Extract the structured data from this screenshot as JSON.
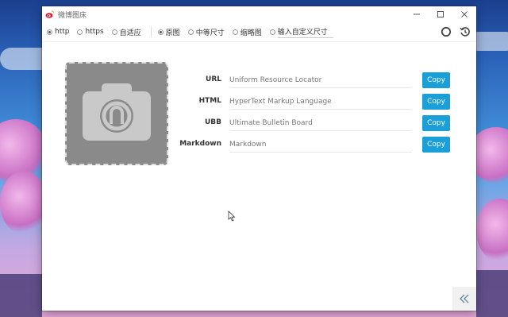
{
  "window": {
    "title": "微博图床"
  },
  "toolbar": {
    "protocols": [
      {
        "label": "http",
        "checked": true
      },
      {
        "label": "https",
        "checked": false
      },
      {
        "label": "自适应",
        "checked": false
      }
    ],
    "sizes": [
      {
        "label": "原图",
        "checked": true
      },
      {
        "label": "中等尺寸",
        "checked": false
      },
      {
        "label": "缩略图",
        "checked": false
      },
      {
        "label": "输入自定义尺寸",
        "checked": false
      }
    ]
  },
  "links": [
    {
      "label": "URL",
      "value": "Uniform Resource Locator",
      "button": "Copy"
    },
    {
      "label": "HTML",
      "value": "HyperText Markup Language",
      "button": "Copy"
    },
    {
      "label": "UBB",
      "value": "Ultimate Bulletin Board",
      "button": "Copy"
    },
    {
      "label": "Markdown",
      "value": "Markdown",
      "button": "Copy"
    }
  ],
  "colors": {
    "accent": "#1a9fd8",
    "placeholder_bg": "#8a8a8a"
  },
  "icons": {
    "toolbar_right": [
      "circle-icon",
      "history-icon"
    ],
    "collapse": "double-chevron-left-icon",
    "preview": "camera-icon"
  }
}
